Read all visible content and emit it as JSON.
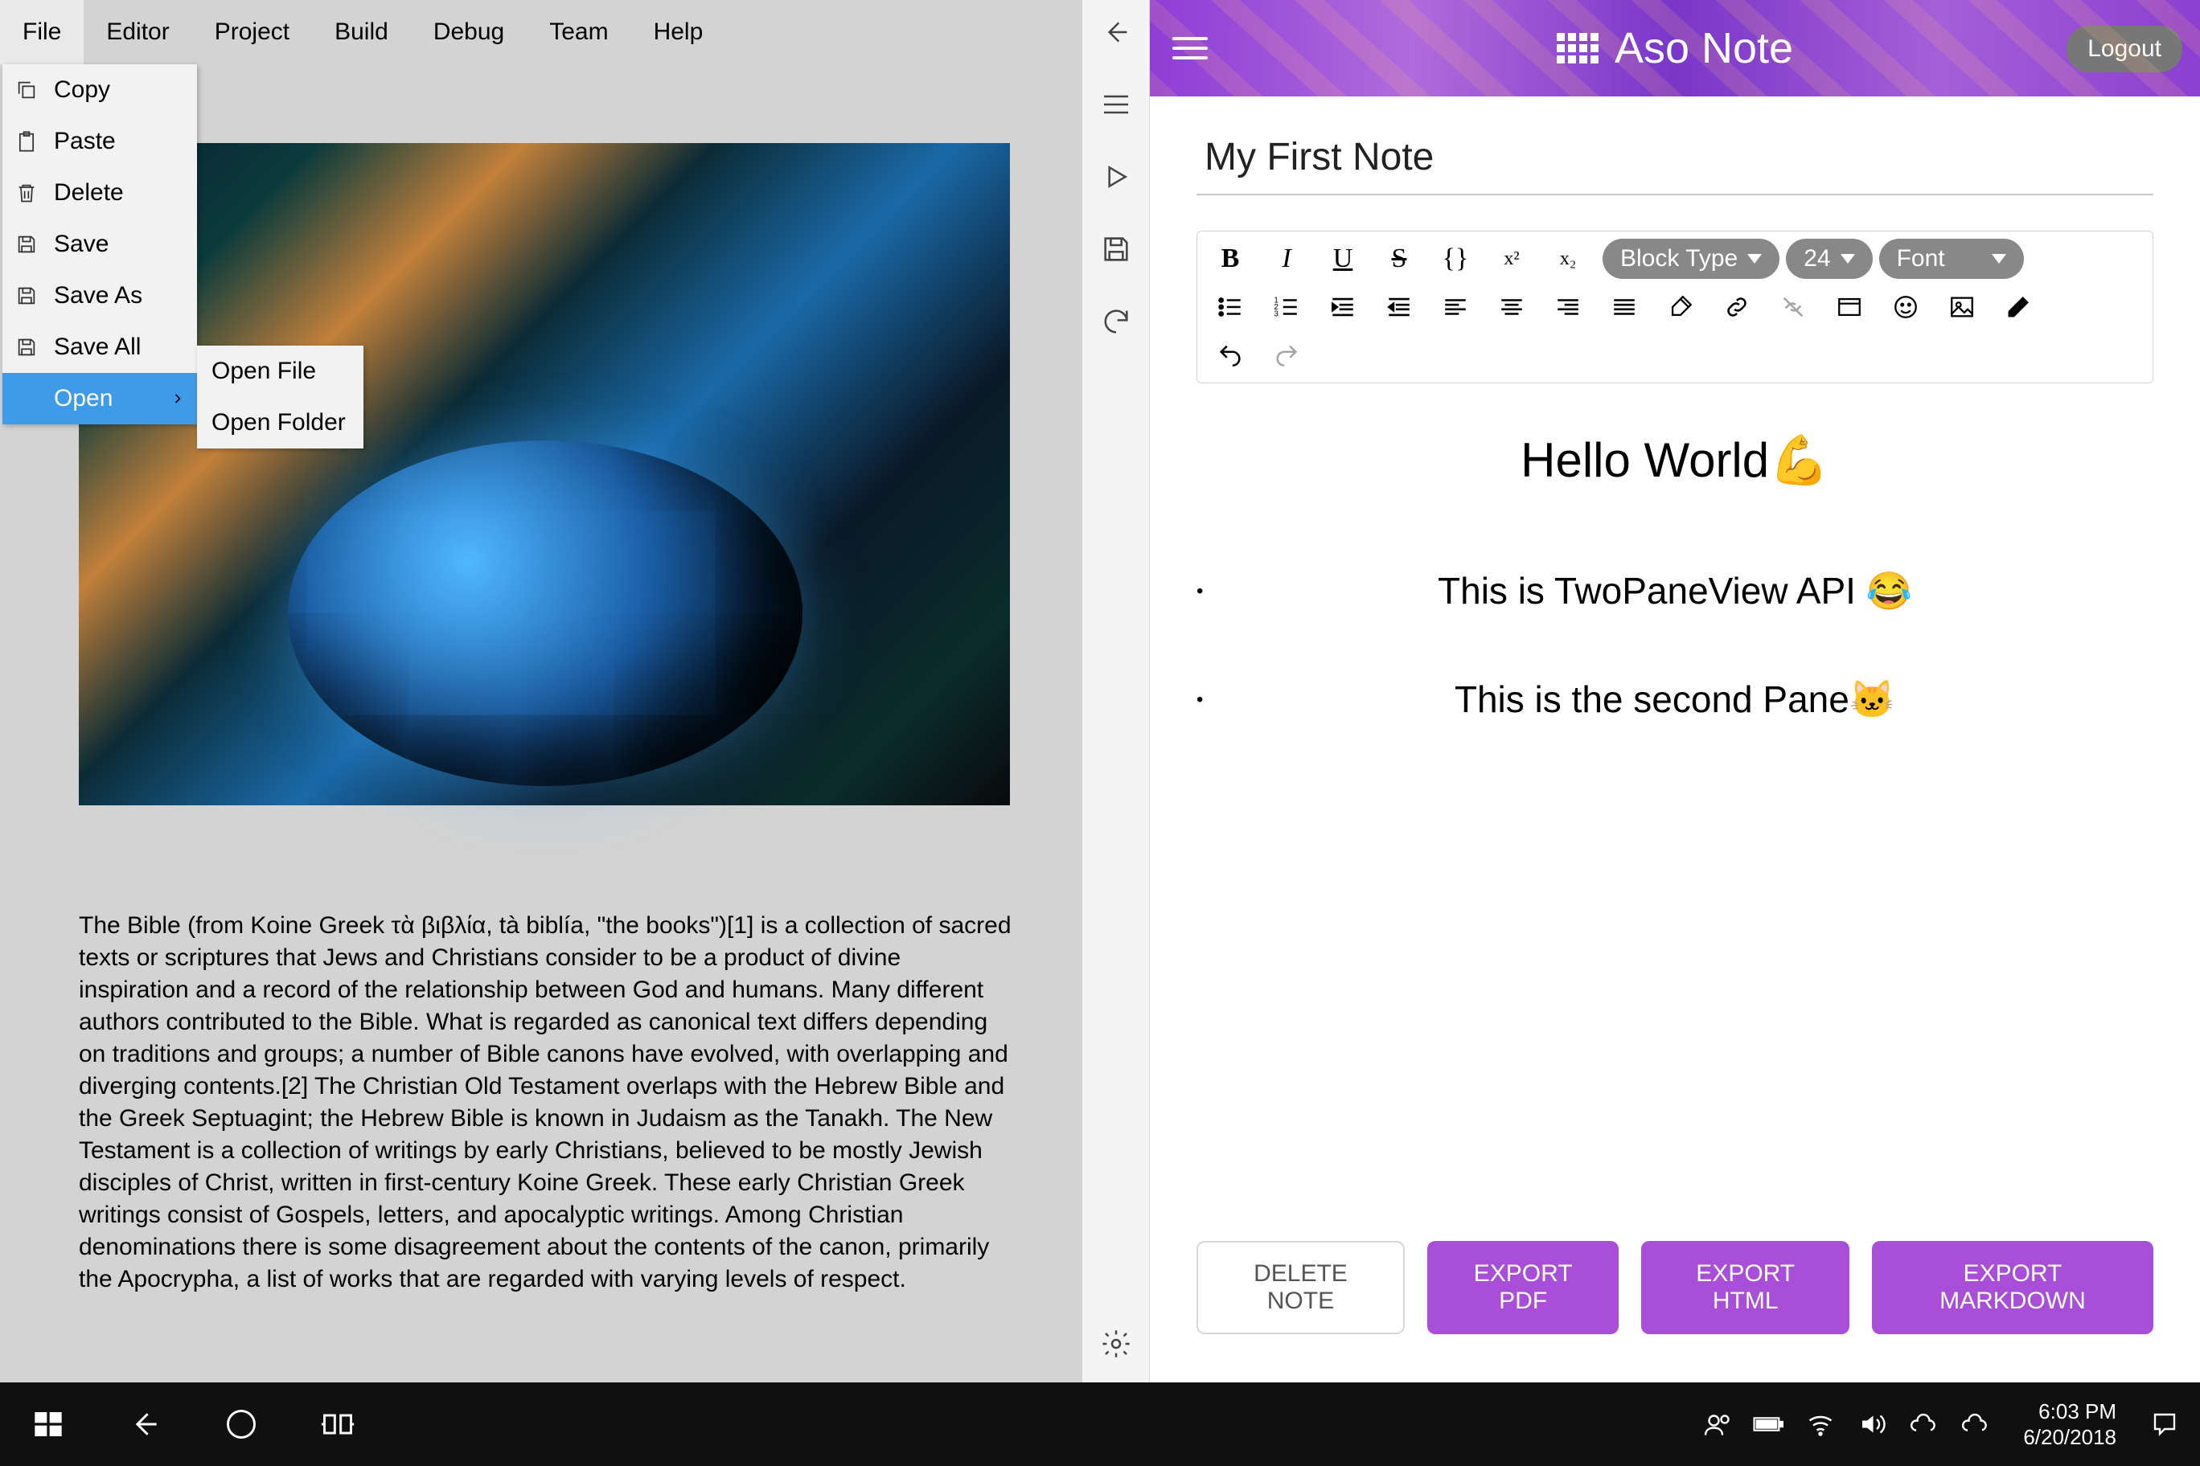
{
  "menubar": [
    "File",
    "Editor",
    "Project",
    "Build",
    "Debug",
    "Team",
    "Help"
  ],
  "file_menu": {
    "items": [
      {
        "icon": "copy",
        "label": "Copy"
      },
      {
        "icon": "paste",
        "label": "Paste"
      },
      {
        "icon": "delete",
        "label": "Delete"
      },
      {
        "icon": "save",
        "label": "Save"
      },
      {
        "icon": "save",
        "label": "Save As"
      },
      {
        "icon": "save",
        "label": "Save All"
      },
      {
        "icon": "",
        "label": "Open",
        "hovered": true,
        "chevron": true
      }
    ],
    "submenu": [
      "Open File",
      "Open Folder"
    ]
  },
  "body_text": "The Bible (from Koine Greek τὰ βιβλία, tà biblía, \"the books\")[1] is a collection of sacred texts or scriptures that Jews and Christians consider to be a product of divine inspiration and a record of the relationship between God and humans. Many different authors contributed to the Bible. What is regarded as canonical text differs depending on traditions and groups; a number of Bible canons have evolved, with overlapping and diverging contents.[2] The Christian Old Testament overlaps with the Hebrew Bible and the Greek Septuagint; the Hebrew Bible is known in Judaism as the Tanakh. The New Testament is a collection of writings by early Christians, believed to be mostly Jewish disciples of Christ, written in first-century Koine Greek. These early Christian Greek writings consist of Gospels, letters, and apocalyptic writings. Among Christian denominations there is some disagreement about the contents of the canon, primarily the Apocrypha, a list of works that are regarded with varying levels of respect.",
  "right": {
    "app_title": "Aso Note",
    "logout": "Logout",
    "note_title": "My First Note",
    "block_type": "Block Type",
    "font_size": "24",
    "font": "Font",
    "heading": "Hello World💪",
    "line1": "This is TwoPaneView API 😂",
    "line2": "This is the second Pane🐱",
    "btn_delete": "DELETE NOTE",
    "btn_pdf": "EXPORT PDF",
    "btn_html": "EXPORT HTML",
    "btn_md": "EXPORT MARKDOWN"
  },
  "taskbar": {
    "time": "6:03 PM",
    "date": "6/20/2018"
  }
}
